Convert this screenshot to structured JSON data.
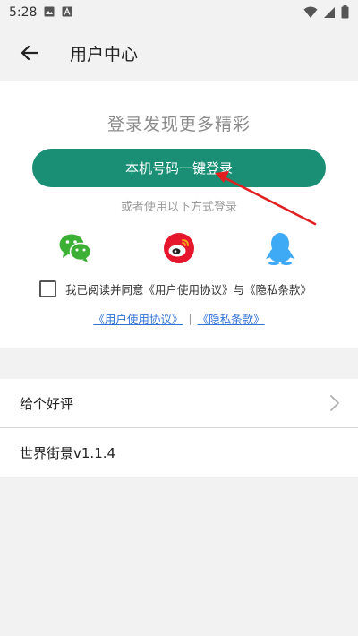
{
  "status_bar": {
    "time": "5:28",
    "icons_left": [
      "image-icon",
      "a-badge-icon"
    ],
    "icons_right": [
      "wifi-icon",
      "signal-icon",
      "battery-icon"
    ]
  },
  "app_bar": {
    "title": "用户中心"
  },
  "login": {
    "headline": "登录发现更多精彩",
    "onekey_label": "本机号码一键登录",
    "alt_text": "或者使用以下方式登录",
    "social": [
      "wechat-icon",
      "weibo-icon",
      "qq-icon"
    ],
    "agreement_text": "我已阅读并同意《用户使用协议》与《隐私条款》",
    "agreement_checked": false,
    "link_user_agreement": "《用户使用协议》",
    "link_separator": "|",
    "link_privacy": "《隐私条款》"
  },
  "menu": {
    "items": [
      {
        "label": "给个好评"
      },
      {
        "label": "世界街景v1.1.4"
      }
    ]
  },
  "colors": {
    "accent": "#1a8f76",
    "link": "#2f72d6",
    "wechat": "#3cb034",
    "weibo": "#e6162d",
    "qq": "#3ea9f5",
    "annotation_arrow": "#e02020"
  }
}
